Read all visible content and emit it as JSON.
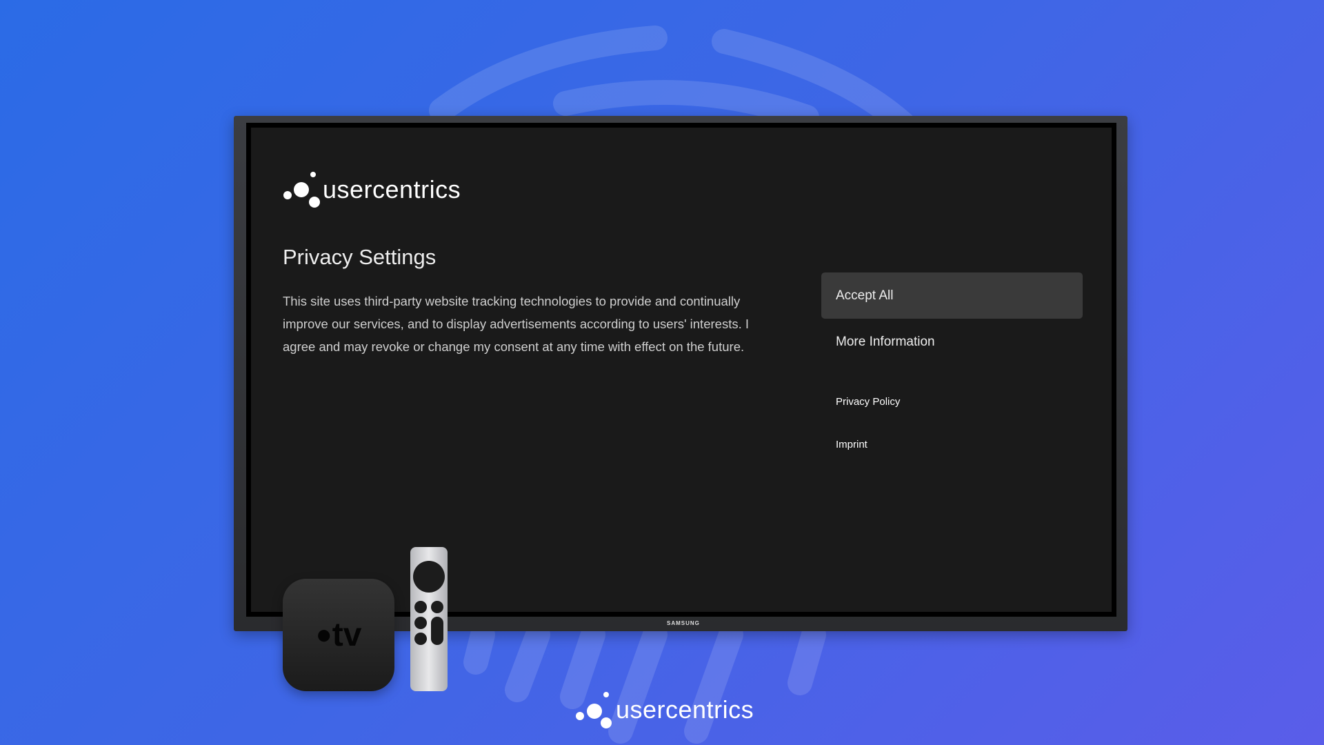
{
  "tv_screen": {
    "brand_logo_text": "usercentrics",
    "title": "Privacy Settings",
    "description": "This site uses third-party website tracking technologies to provide and continually improve our services, and to display advertisements according to users' interests. I agree and may revoke or change my consent at any time with effect on the future.",
    "buttons": [
      {
        "label": "Accept All",
        "focused": true
      },
      {
        "label": "More Information",
        "focused": false
      }
    ],
    "links": [
      "Privacy Policy",
      "Imprint"
    ]
  },
  "tv_brand": "SAMSUNG",
  "device_label": "tv",
  "footer_logo_text": "usercentrics",
  "colors": {
    "background_start": "#2b6be6",
    "background_end": "#5a5de9",
    "screen_bg": "#1a1a1a",
    "focused_button": "#3a3a3a"
  }
}
